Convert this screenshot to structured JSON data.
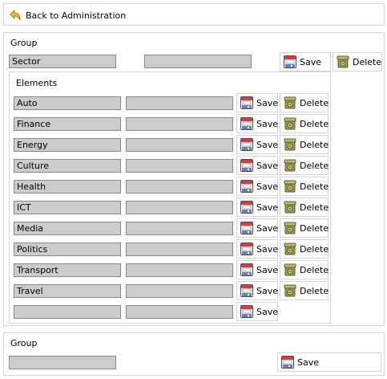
{
  "nav": {
    "back_label": "Back to Administration"
  },
  "group": {
    "label": "Group",
    "name_value": "Sector",
    "second_value": "",
    "save_label": "Save",
    "delete_label": "Delete",
    "elements": {
      "label": "Elements",
      "rows": [
        {
          "name": "Auto",
          "value": "",
          "save_label": "Save",
          "delete_label": "Delete"
        },
        {
          "name": "Finance",
          "value": "",
          "save_label": "Save",
          "delete_label": "Delete"
        },
        {
          "name": "Energy",
          "value": "",
          "save_label": "Save",
          "delete_label": "Delete"
        },
        {
          "name": "Culture",
          "value": "",
          "save_label": "Save",
          "delete_label": "Delete"
        },
        {
          "name": "Health",
          "value": "",
          "save_label": "Save",
          "delete_label": "Delete"
        },
        {
          "name": "ICT",
          "value": "",
          "save_label": "Save",
          "delete_label": "Delete"
        },
        {
          "name": "Media",
          "value": "",
          "save_label": "Save",
          "delete_label": "Delete"
        },
        {
          "name": "Politics",
          "value": "",
          "save_label": "Save",
          "delete_label": "Delete"
        },
        {
          "name": "Transport",
          "value": "",
          "save_label": "Save",
          "delete_label": "Delete"
        },
        {
          "name": "Travel",
          "value": "",
          "save_label": "Save",
          "delete_label": "Delete"
        }
      ],
      "new_row": {
        "name": "",
        "value": "",
        "save_label": "Save"
      }
    }
  },
  "new_group": {
    "label": "Group",
    "name_value": "",
    "save_label": "Save"
  },
  "icons": {
    "back": "back-arrow-icon",
    "save": "floppy-disk-icon",
    "delete": "trash-bin-icon"
  },
  "colors": {
    "field_bg": "#cccccc",
    "field_border": "#8a8a8a",
    "panel_border": "#d4d4d4",
    "arrow_yellow": "#f2c200",
    "floppy_red": "#d93a3a",
    "floppy_blue": "#6b7fb0",
    "bin_olive": "#9a9a52"
  }
}
